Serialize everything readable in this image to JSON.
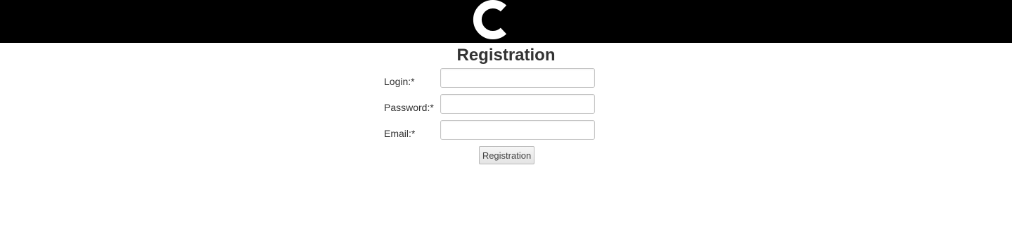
{
  "header": {
    "logo_icon": "c-letter-logo-icon",
    "logo_letter": "C",
    "background": "#000000",
    "logo_color": "#ffffff"
  },
  "form": {
    "title": "Registration",
    "fields": [
      {
        "label": "Login:*",
        "value": "",
        "placeholder": ""
      },
      {
        "label": "Password:*",
        "value": "",
        "placeholder": ""
      },
      {
        "label": "Email:*",
        "value": "",
        "placeholder": ""
      }
    ],
    "submit_label": "Registration"
  }
}
